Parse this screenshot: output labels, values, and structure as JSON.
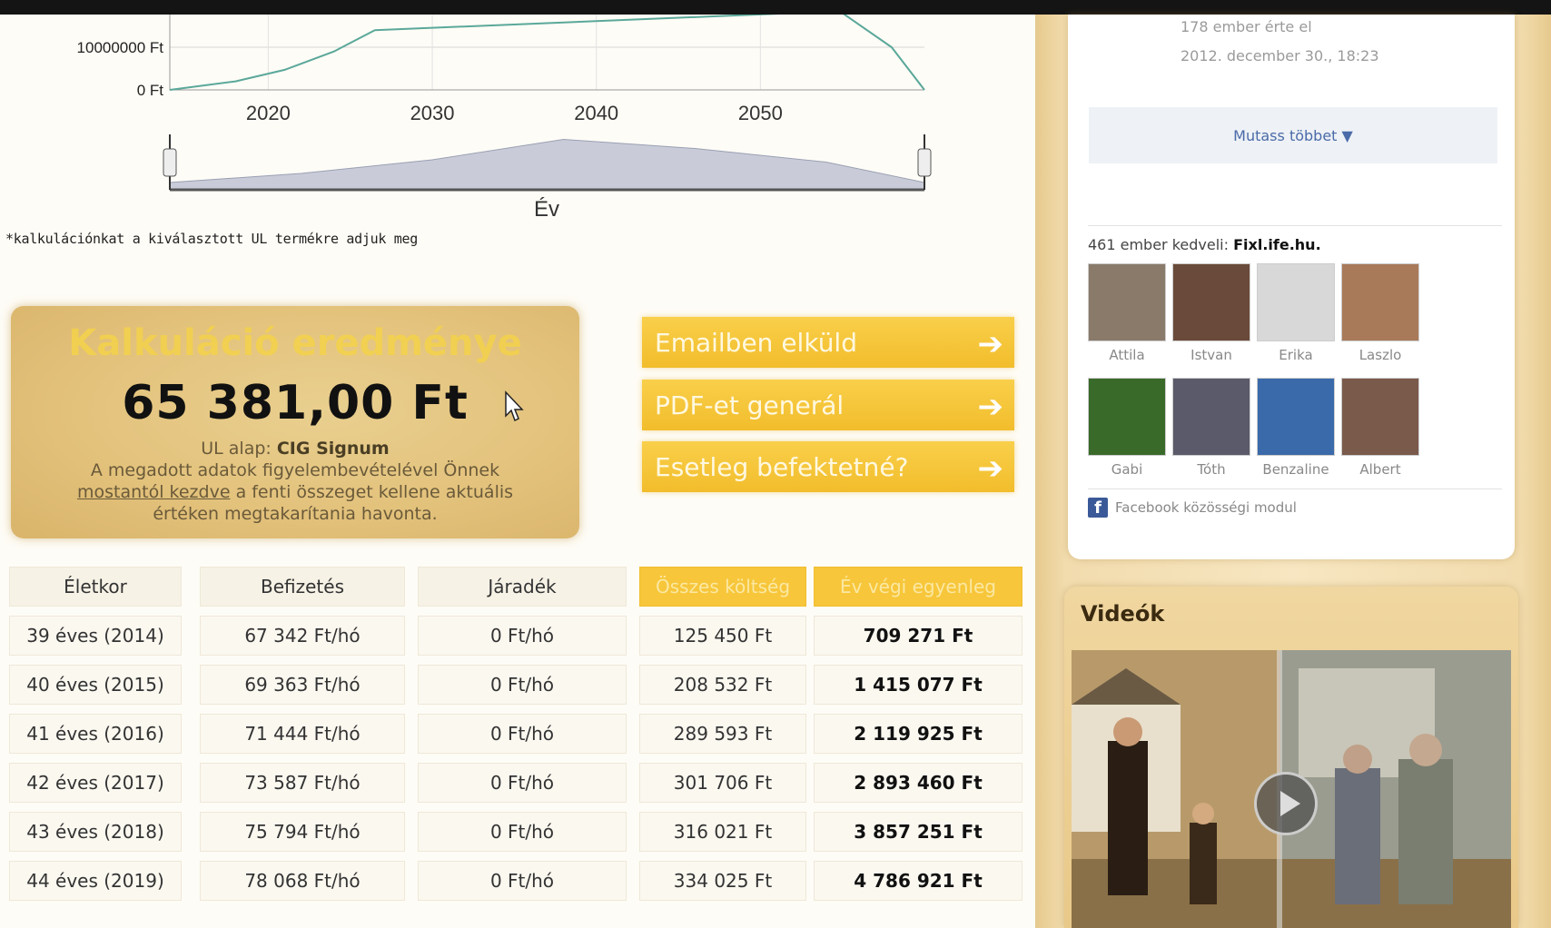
{
  "chart_data": {
    "type": "line",
    "ylabel": "",
    "y_ticks": [
      "10000000 Ft",
      "0 Ft"
    ],
    "x_ticks": [
      "2020",
      "2030",
      "2040",
      "2050"
    ],
    "navigator_label": "Év",
    "series": [
      {
        "values": [
          0,
          2000000,
          4700000,
          9000000,
          14000000,
          18000000,
          18000000,
          10000000,
          0
        ]
      },
      {
        "x": [
          2014,
          2022,
          2030,
          2038,
          2046,
          2054,
          2060
        ],
        "values": [
          0,
          0.2,
          0.5,
          0.95,
          0.75,
          0.45,
          0
        ]
      }
    ]
  },
  "note": "*kalkulációnkat a kiválasztott UL termékre adjuk meg",
  "result": {
    "title": "Kalkuláció eredménye",
    "amount": "65 381,00 Ft",
    "base_label": "UL alap:",
    "base_value": "CIG Signum",
    "desc_1": "A megadott adatok figyelembevételével Önnek",
    "desc_link": "mostantól kezdve",
    "desc_2": "a fenti összeget kellene aktuális értéken megtakarítania havonta."
  },
  "actions": {
    "email": "Emailben elküld",
    "pdf": "PDF-et generál",
    "invest": "Esetleg befektetné?"
  },
  "table": {
    "headers": [
      "Életkor",
      "Befizetés",
      "Járadék",
      "Összes költség",
      "Év végi egyenleg"
    ],
    "rows": [
      [
        "39 éves (2014)",
        "67 342 Ft/hó",
        "0 Ft/hó",
        "125 450 Ft",
        "709 271 Ft"
      ],
      [
        "40 éves (2015)",
        "69 363 Ft/hó",
        "0 Ft/hó",
        "208 532 Ft",
        "1 415 077 Ft"
      ],
      [
        "41 éves (2016)",
        "71 444 Ft/hó",
        "0 Ft/hó",
        "289 593 Ft",
        "2 119 925 Ft"
      ],
      [
        "42 éves (2017)",
        "73 587 Ft/hó",
        "0 Ft/hó",
        "301 706 Ft",
        "2 893 460 Ft"
      ],
      [
        "43 éves (2018)",
        "75 794 Ft/hó",
        "0 Ft/hó",
        "316 021 Ft",
        "3 857 251 Ft"
      ],
      [
        "44 éves (2019)",
        "78 068 Ft/hó",
        "0 Ft/hó",
        "334 025 Ft",
        "4 786 921 Ft"
      ]
    ]
  },
  "fb": {
    "like_count": "178 ember érte el",
    "timestamp": "2012. december 30., 18:23",
    "show_more": "Mutass többet ▼",
    "likes_prefix": "461 ember kedveli:",
    "likes_page": "Fixl.ife.hu.",
    "fans": [
      "Attila",
      "Istvan",
      "Erika",
      "Laszlo",
      "Gabi",
      "Tóth",
      "Benzaline",
      "Albert"
    ],
    "module": "Facebook közösségi modul"
  },
  "videos": {
    "title": "Videók"
  },
  "colors": {
    "accent": "#f7c63a",
    "panel": "#e3c27c",
    "fb": "#3b5998"
  }
}
